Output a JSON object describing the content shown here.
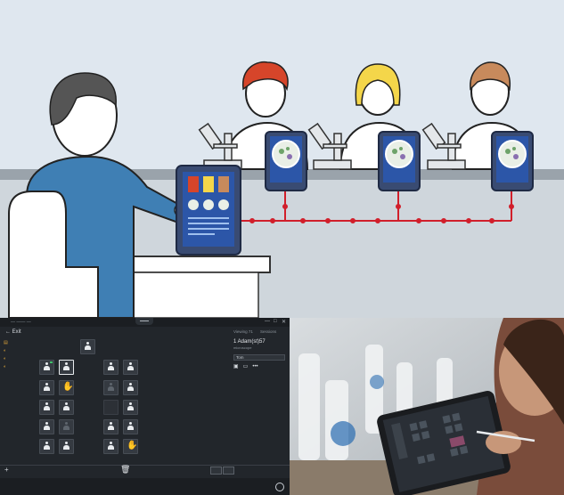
{
  "illustration": {
    "palette": {
      "background": "#dfe7ef",
      "teacher_shirt": "#3f7fb4",
      "table": "#ffffff",
      "network": "#d11f2b",
      "tablet": "#394b72",
      "screen": "#2c56a8"
    },
    "students": [
      {
        "hair": "#d6452a"
      },
      {
        "hair": "#f4d64a"
      },
      {
        "hair": "#c88a5c"
      }
    ]
  },
  "app": {
    "window_title": "— —— —",
    "exit_label": "← Exit",
    "left_icons": [
      "▤",
      "◐",
      "◐",
      "◐"
    ],
    "tabs": [
      "Viewing 71",
      "Sessions"
    ],
    "student_name": "1 Adam(st)57",
    "student_sub": "microscope",
    "dropdown_value": "Tom",
    "panel_icons": [
      "▣",
      "▭",
      "•••"
    ],
    "plus_label": "+",
    "trash_icon": "trash-icon",
    "window_controls": [
      "—",
      "□",
      "✕"
    ]
  },
  "photo": {
    "accent": "#2b6cb0"
  }
}
